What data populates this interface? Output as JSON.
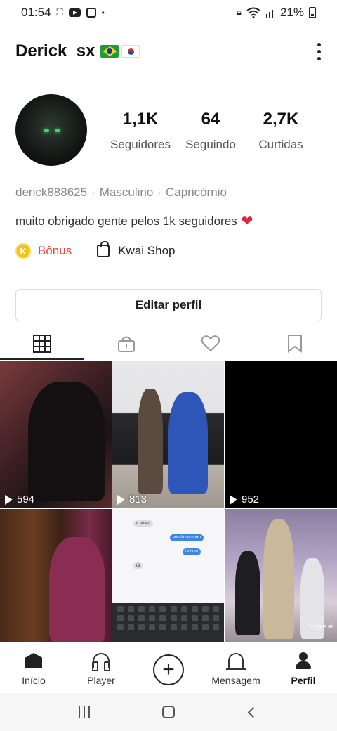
{
  "status_bar": {
    "time": "01:54",
    "battery": "21%"
  },
  "profile": {
    "name": "Derick  sx",
    "flags": [
      "brazil-flag",
      "south-korea-flag"
    ],
    "stats": [
      {
        "value": "1,1K",
        "label": "Seguidores"
      },
      {
        "value": "64",
        "label": "Seguindo"
      },
      {
        "value": "2,7K",
        "label": "Curtidas"
      }
    ],
    "handle": "derick888625",
    "gender": "Masculino",
    "sign": "Capricórnio",
    "separator": "·",
    "bio": "muito obrigado gente pelos 1k seguidores",
    "bio_emoji": "❤"
  },
  "links": {
    "bonus_badge": "K",
    "bonus_label": "Bônus",
    "shop_label": "Kwai Shop"
  },
  "edit_button": "Editar perfil",
  "tabs": [
    {
      "icon": "grid-icon",
      "active": true
    },
    {
      "icon": "lock-icon",
      "active": false
    },
    {
      "icon": "heart-icon",
      "active": false
    },
    {
      "icon": "bookmark-icon",
      "active": false
    }
  ],
  "videos": [
    {
      "views": "594"
    },
    {
      "views": "813"
    },
    {
      "views": "952"
    },
    {
      "views": ""
    },
    {
      "views": "",
      "chat": [
        "o vídeo",
        "vou fazer outro",
        "tá bom",
        "tá"
      ]
    },
    {
      "views": "",
      "watermark": "Viggle.ai"
    }
  ],
  "bottom_nav": [
    {
      "label": "Início",
      "icon": "home-icon"
    },
    {
      "label": "Player",
      "icon": "headphones-icon"
    },
    {
      "label": "",
      "icon": "plus-icon"
    },
    {
      "label": "Mensagem",
      "icon": "bell-icon"
    },
    {
      "label": "Perfil",
      "icon": "person-icon",
      "active": true
    }
  ],
  "colors": {
    "bonus_red": "#e0463a",
    "coin_yellow": "#f5c21b",
    "heart_red": "#e0243a"
  }
}
